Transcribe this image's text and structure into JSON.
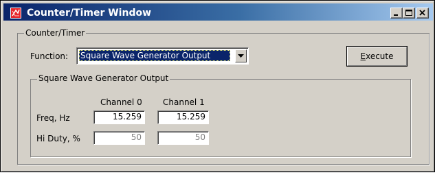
{
  "window": {
    "title": "Counter/Timer Window"
  },
  "counter_timer": {
    "group_label": "Counter/Timer",
    "function_label": "Function:",
    "function_selected": "Square Wave Generator Output",
    "execute_label_prefix": "E",
    "execute_label_rest": "xecute"
  },
  "sqwave": {
    "group_label": "Square Wave Generator Output",
    "channel0_header": "Channel 0",
    "channel1_header": "Channel 1",
    "freq_label": "Freq, Hz",
    "duty_label": "Hi Duty, %",
    "freq_ch0": "15.259",
    "freq_ch1": "15.259",
    "duty_ch0": "50",
    "duty_ch1": "50"
  }
}
